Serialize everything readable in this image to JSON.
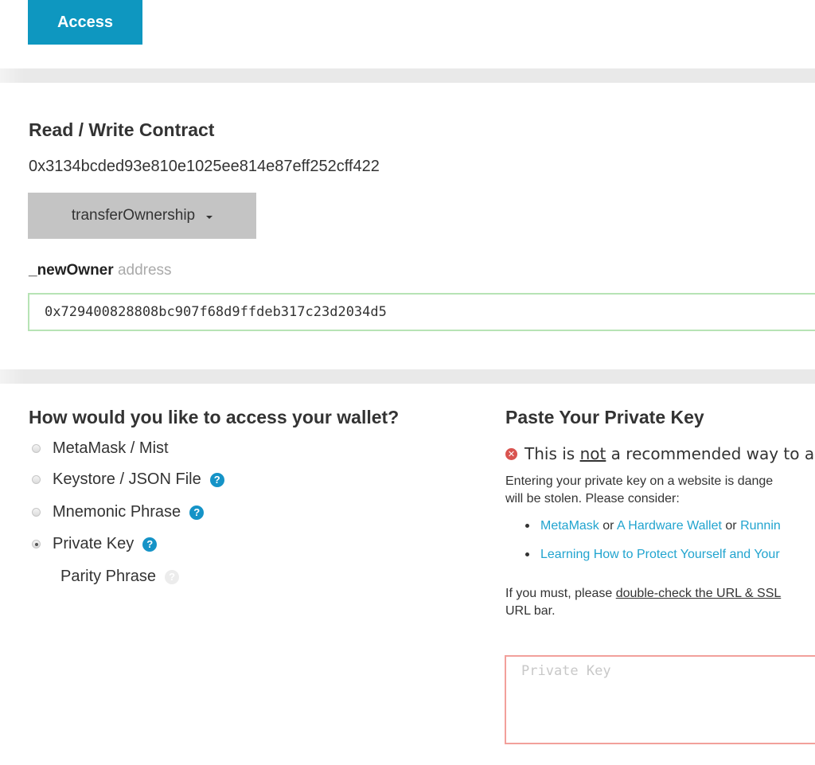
{
  "top": {
    "access_button": "Access"
  },
  "contract": {
    "title": "Read / Write Contract",
    "address": "0x3134bcded93e810e1025ee814e87eff252cff422",
    "selected_function": "transferOwnership",
    "param_name": "_newOwner",
    "param_type": "address",
    "param_value": "0x729400828808bc907f68d9ffdeb317c23d2034d5"
  },
  "wallet": {
    "title": "How would you like to access your wallet?",
    "options": [
      {
        "label": "MetaMask / Mist",
        "help": false,
        "checked": false
      },
      {
        "label": "Keystore / JSON File",
        "help": true,
        "checked": false
      },
      {
        "label": "Mnemonic Phrase",
        "help": true,
        "checked": false
      },
      {
        "label": "Private Key",
        "help": true,
        "checked": true
      }
    ],
    "parity_label": "Parity Phrase",
    "help_glyph": "?"
  },
  "private_key": {
    "title": "Paste Your Private Key",
    "warn_prefix": "This is ",
    "warn_emph": "not",
    "warn_suffix": " a recommended way to ac",
    "warn_icon": "✕",
    "para1_line1": "Entering your private key on a website is dange",
    "para1_line2": "will be stolen. Please consider:",
    "bullet1": {
      "link1": "MetaMask",
      "or1": " or ",
      "link2": "A Hardware Wallet",
      "or2": " or ",
      "link3": "Runnin"
    },
    "bullet2": {
      "link": "Learning How to Protect Yourself and Your"
    },
    "para2_prefix": "If you must, please ",
    "para2_link": "double-check the URL & SSL",
    "para2_line2": "URL bar.",
    "placeholder": "Private Key"
  }
}
